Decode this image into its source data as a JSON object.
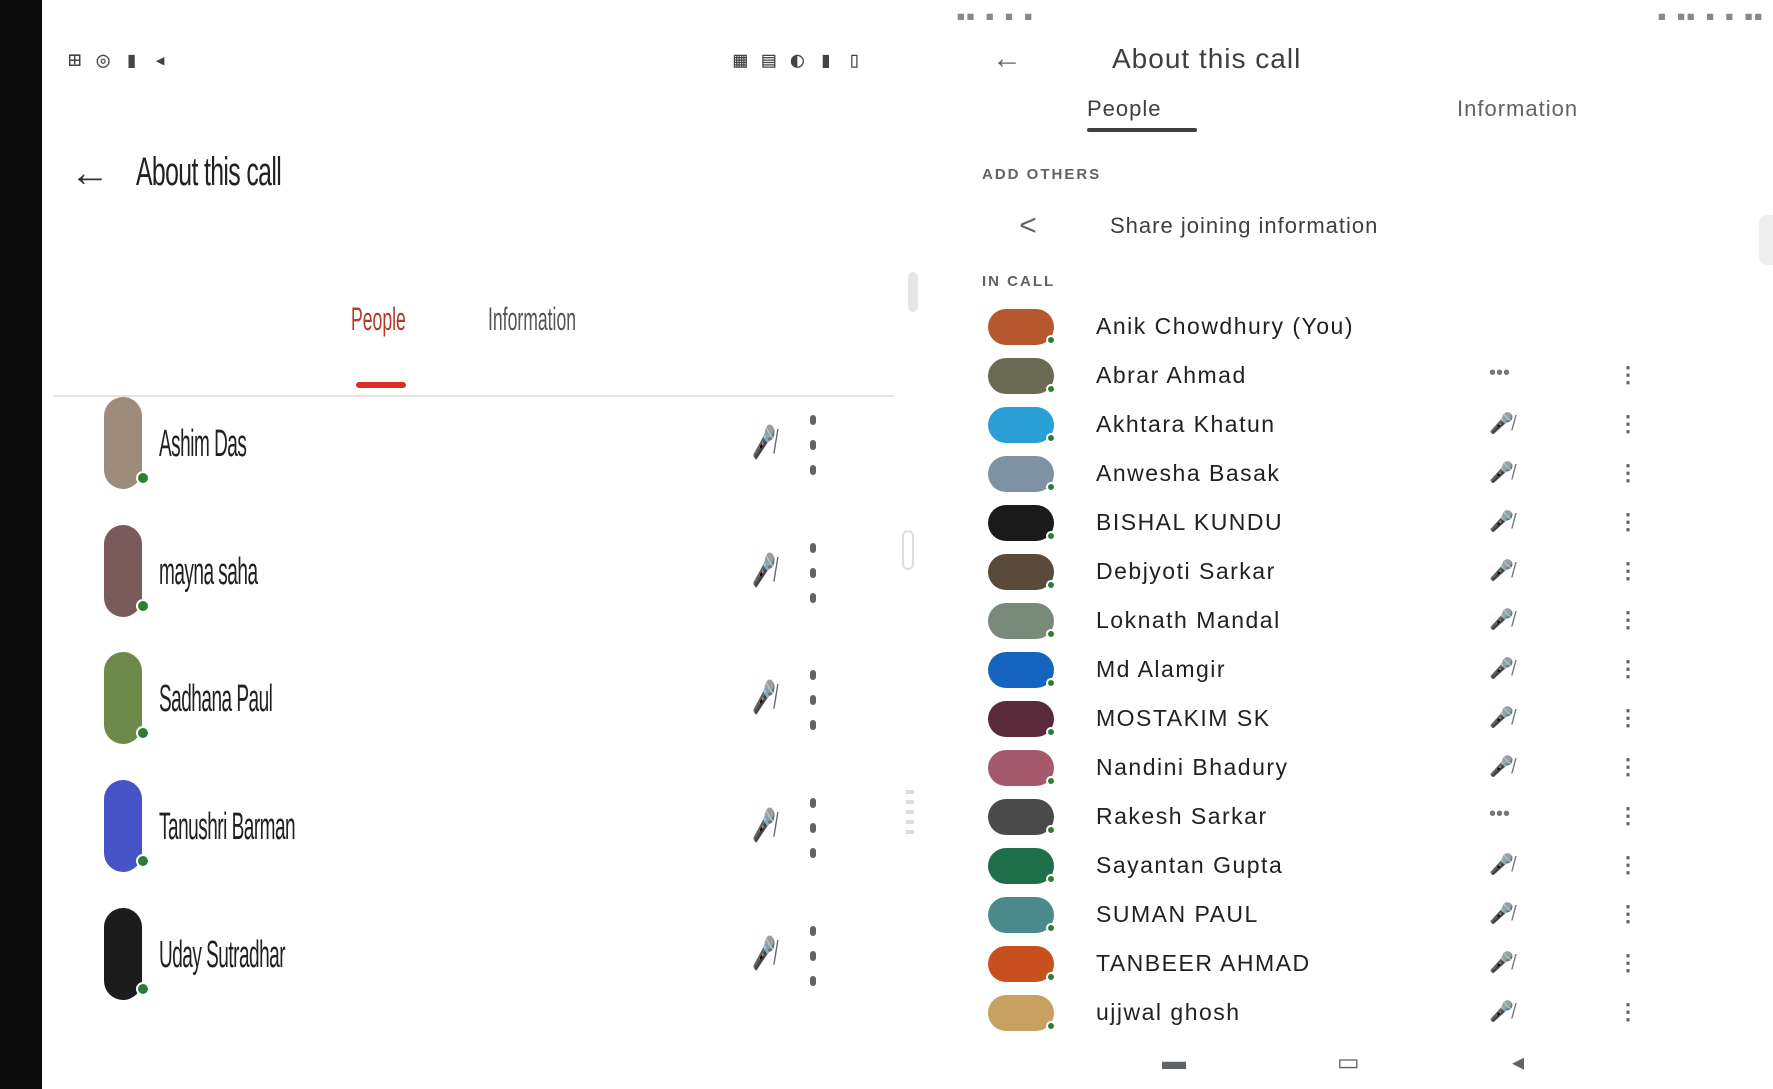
{
  "left": {
    "status_left": "⊞ ◎ ▮ ◂",
    "status_right": "▦ ▤ ◐ ▮ ▯",
    "title": "About this call",
    "tabs": [
      {
        "label": "People"
      },
      {
        "label": "Information"
      }
    ],
    "participants": [
      {
        "name": "Ashim Das",
        "color": "#9e8c7a"
      },
      {
        "name": "mayna saha",
        "color": "#7a5a5a"
      },
      {
        "name": "Sadhana Paul",
        "color": "#6d8a4a"
      },
      {
        "name": "Tanushri Barman",
        "color": "#4654c8"
      },
      {
        "name": "Uday Sutradhar",
        "color": "#1c1c1c"
      }
    ]
  },
  "right": {
    "status_left": "▪▪ ▪ ▪ ▪",
    "status_right": "▪ ▪▪ ▪ ▪ ▪▪",
    "title": "About this call",
    "tabs": [
      {
        "label": "People"
      },
      {
        "label": "Information"
      }
    ],
    "add_others_header": "ADD OTHERS",
    "share_label": "Share joining information",
    "in_call_header": "IN CALL",
    "participants": [
      {
        "name": "Anik Chowdhury (You)",
        "status": "",
        "more": "",
        "color": "#b5572f"
      },
      {
        "name": "Abrar Ahmad",
        "status": "•••",
        "more": "⋮",
        "color": "#6b6b54"
      },
      {
        "name": "Akhtara Khatun",
        "status": "🎤̸",
        "more": "⋮",
        "color": "#2a9fd6"
      },
      {
        "name": "Anwesha Basak",
        "status": "🎤̸",
        "more": "⋮",
        "color": "#7d93a3"
      },
      {
        "name": "BISHAL KUNDU",
        "status": "🎤̸",
        "more": "⋮",
        "color": "#1a1a1a"
      },
      {
        "name": "Debjyoti Sarkar",
        "status": "🎤̸",
        "more": "⋮",
        "color": "#5a4a3a"
      },
      {
        "name": "Loknath Mandal",
        "status": "🎤̸",
        "more": "⋮",
        "color": "#7a8a7a"
      },
      {
        "name": "Md Alamgir",
        "status": "🎤̸",
        "more": "⋮",
        "color": "#1565c0"
      },
      {
        "name": "MOSTAKIM SK",
        "status": "🎤̸",
        "more": "⋮",
        "color": "#5a2a3a"
      },
      {
        "name": "Nandini Bhadury",
        "status": "🎤̸",
        "more": "⋮",
        "color": "#a45a6a"
      },
      {
        "name": "Rakesh Sarkar",
        "status": "•••",
        "more": "⋮",
        "color": "#4a4a4a"
      },
      {
        "name": "Sayantan Gupta",
        "status": "🎤̸",
        "more": "⋮",
        "color": "#1f6e4a"
      },
      {
        "name": "SUMAN PAUL",
        "status": "🎤̸",
        "more": "⋮",
        "color": "#4a8a8a"
      },
      {
        "name": "TANBEER AHMAD",
        "status": "🎤̸",
        "more": "⋮",
        "color": "#c8501e"
      },
      {
        "name": "ujjwal ghosh",
        "status": "🎤̸",
        "more": "⋮",
        "color": "#c8a060"
      }
    ],
    "nav": [
      {
        "icon": "▬"
      },
      {
        "icon": "▭"
      },
      {
        "icon": "◂"
      }
    ]
  }
}
